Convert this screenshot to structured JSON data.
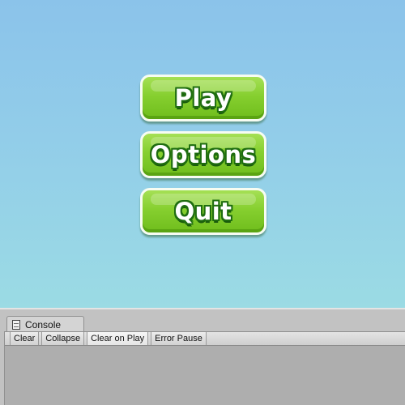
{
  "menu": {
    "buttons": [
      {
        "label": "Play"
      },
      {
        "label": "Options"
      },
      {
        "label": "Quit"
      }
    ]
  },
  "console": {
    "tab_label": "Console",
    "tab_icon": "console-icon",
    "toolbar": [
      {
        "label": "Clear"
      },
      {
        "label": "Collapse"
      },
      {
        "label": "Clear on Play"
      },
      {
        "label": "Error Pause"
      }
    ]
  },
  "colors": {
    "sky_top": "#8bc3ea",
    "sky_bottom": "#9bdbe4",
    "button_green": "#86cf2f",
    "button_outline": "#1f6d10",
    "panel_gray": "#c2c2c2"
  }
}
